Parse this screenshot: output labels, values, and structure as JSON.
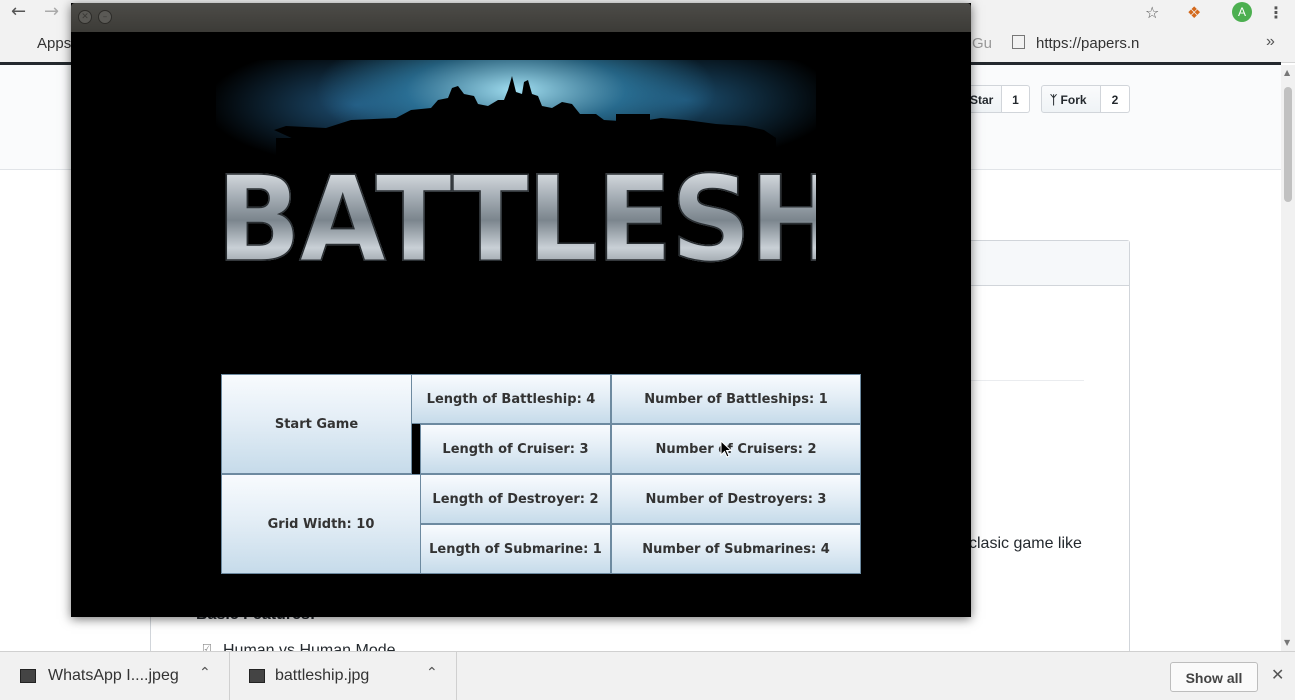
{
  "browser": {
    "bookmarks": {
      "apps_label": "Apps",
      "truncated_left": "Gu",
      "url_label": "https://papers.n"
    },
    "avatar_letter": "A"
  },
  "page": {
    "star_label": "Star",
    "star_count": "1",
    "fork_label": "Fork",
    "fork_count": "2",
    "readme_fragment": "clasic game like",
    "section_heading": "Basic Features:",
    "list_item": "Human vs Human Mode"
  },
  "game": {
    "title_art_text": "BATTLESHIP",
    "start_button": "Start Game",
    "grid_width_button": "Grid Width: 10",
    "settings": [
      {
        "length": "Length of Battleship: 4",
        "number": "Number of Battleships: 1"
      },
      {
        "length": "Length of Cruiser: 3",
        "number": "Number of Cruisers: 2"
      },
      {
        "length": "Length of Destroyer: 2",
        "number": "Number of Destroyers: 3"
      },
      {
        "length": "Length of Submarine: 1",
        "number": "Number of Submarines: 4"
      }
    ]
  },
  "downloads": {
    "items": [
      {
        "name": "WhatsApp I....jpeg"
      },
      {
        "name": "battleship.jpg"
      }
    ],
    "show_all": "Show all"
  },
  "icons": [
    "back-arrow-icon",
    "forward-arrow-icon",
    "star-bookmark-icon",
    "extension-icon",
    "menu-icon",
    "apps-icon",
    "page-icon",
    "chevron-right-icon",
    "fork-icon",
    "close-icon",
    "minimize-icon",
    "chevron-up-icon",
    "file-icon"
  ]
}
